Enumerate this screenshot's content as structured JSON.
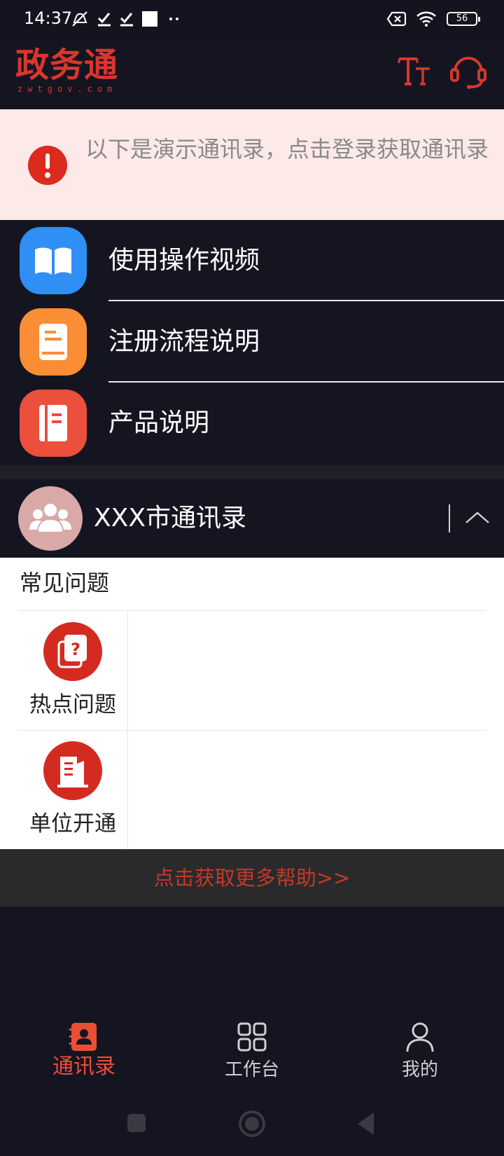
{
  "status_bar": {
    "time": "14:37",
    "battery": "56"
  },
  "header": {
    "logo_text": "政务通",
    "logo_sub": "zwtgov.com",
    "font_size_icon": "font-size-icon",
    "support_icon": "headset-icon"
  },
  "notice": {
    "text": "以下是演示通讯录，点击登录获取通讯录",
    "icon": "alert-icon"
  },
  "menu": {
    "items": [
      {
        "label": "使用操作视频",
        "icon": "book-open-icon",
        "color": "#2f8ff5"
      },
      {
        "label": "注册流程说明",
        "icon": "document-icon",
        "color": "#fb8d34"
      },
      {
        "label": "产品说明",
        "icon": "notebook-icon",
        "color": "#ec4f3c"
      }
    ]
  },
  "directory": {
    "title": "XXX市通讯录",
    "icon": "group-icon",
    "toggle_icon": "chevron-up-icon"
  },
  "faq": {
    "title": "常见问题",
    "items": [
      {
        "label": "热点问题",
        "icon": "question-book-icon"
      },
      {
        "label": "单位开通",
        "icon": "building-icon"
      }
    ]
  },
  "more_help": "点击获取更多帮助>>",
  "bottom_nav": {
    "items": [
      {
        "label": "通讯录",
        "icon": "contacts-icon",
        "active": true
      },
      {
        "label": "工作台",
        "icon": "grid-icon",
        "active": false
      },
      {
        "label": "我的",
        "icon": "person-icon",
        "active": false
      }
    ]
  },
  "colors": {
    "brand_red": "#d8372c",
    "active_tab": "#ea4e36",
    "background": "#151522",
    "notice_bg": "#fce9e8"
  }
}
